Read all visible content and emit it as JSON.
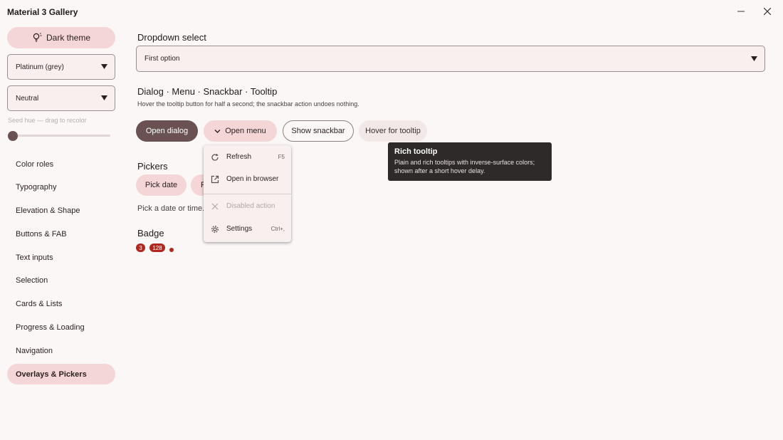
{
  "window": {
    "title": "Material 3 Gallery"
  },
  "sidebar": {
    "theme_button": "Dark theme",
    "palette_select": "Platinum (grey)",
    "variant_select": "Neutral",
    "seed_label": "Seed hue — drag to recolor",
    "seed_hue_fraction": 0.0,
    "items": [
      {
        "label": "Color roles"
      },
      {
        "label": "Typography"
      },
      {
        "label": "Elevation & Shape"
      },
      {
        "label": "Buttons & FAB"
      },
      {
        "label": "Text inputs"
      },
      {
        "label": "Selection"
      },
      {
        "label": "Cards & Lists"
      },
      {
        "label": "Progress & Loading"
      },
      {
        "label": "Navigation"
      },
      {
        "label": "Overlays & Pickers",
        "active": true
      }
    ]
  },
  "main": {
    "dropdown": {
      "title": "Dropdown select",
      "value": "First option"
    },
    "overlays": {
      "title": "Dialog · Menu · Snackbar · Tooltip",
      "subtitle": "Hover the tooltip button for half a second; the snackbar action undoes nothing.",
      "buttons": {
        "open_dialog": "Open dialog",
        "open_menu": "Open menu",
        "show_snackbar": "Show snackbar",
        "hover_tooltip": "Hover for tooltip"
      }
    },
    "menu": {
      "items": [
        {
          "label": "Refresh",
          "shortcut": "F5",
          "icon": "refresh-icon"
        },
        {
          "label": "Open in browser",
          "shortcut": "",
          "icon": "open-external-icon"
        },
        {
          "label": "Disabled action",
          "shortcut": "",
          "icon": "close-icon",
          "disabled": true
        },
        {
          "label": "Settings",
          "shortcut": "Ctrl+,",
          "icon": "gear-icon"
        }
      ]
    },
    "tooltip": {
      "title": "Rich tooltip",
      "body": "Plain and rich tooltips with inverse-surface colors; shown after a short hover delay."
    },
    "pickers": {
      "title": "Pickers",
      "pick_date": "Pick date",
      "pick_time_partial": "P",
      "hint": "Pick a date or time."
    },
    "badge": {
      "title": "Badge",
      "small_count": "3",
      "large_count": "128"
    }
  },
  "colors": {
    "primary": "#6b5252",
    "secondary_container": "#f4d6d6",
    "surface": "#fbf7f7",
    "inverse_surface": "#2f2a2a",
    "error": "#b3261e"
  }
}
